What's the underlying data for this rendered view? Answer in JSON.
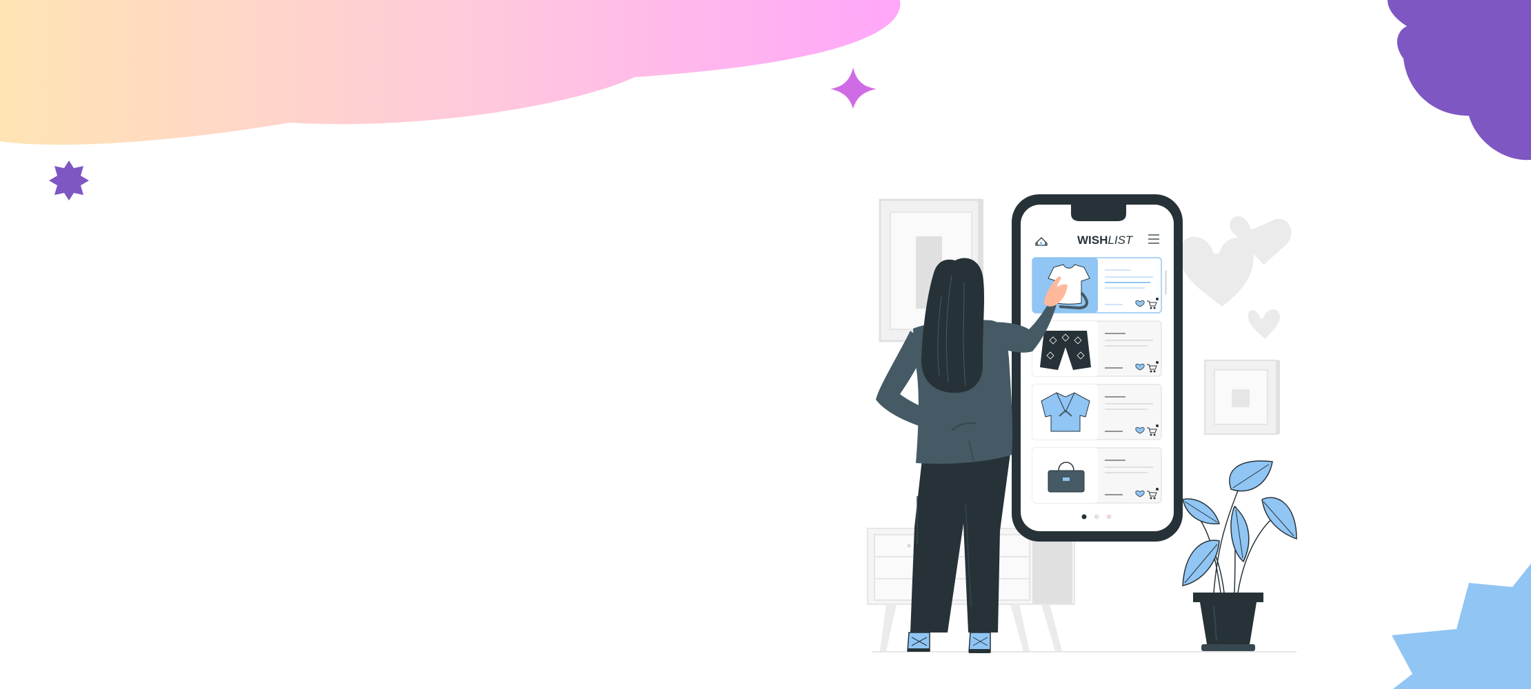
{
  "screen": {
    "title_bold": "WISH",
    "title_italic": "LIST",
    "icons": {
      "home": "home-icon",
      "menu": "hamburger-menu-icon",
      "favorite": "heart-icon",
      "cart": "cart-icon"
    },
    "products": [
      {
        "item": "t-shirt",
        "selected": true
      },
      {
        "item": "shorts",
        "selected": false
      },
      {
        "item": "shirt",
        "selected": false
      },
      {
        "item": "handbag",
        "selected": false
      }
    ],
    "pager": {
      "pages": 3,
      "active": 1
    }
  },
  "colors": {
    "accent_blue": "#90c5f4",
    "dark": "#263238",
    "jacket": "#455a64",
    "purple": "#7e57c2",
    "magenta_star": "#d06be6",
    "gradient_start": "#ffe4b3",
    "gradient_mid": "#ffc8dd",
    "gradient_end": "#ffa6fa"
  }
}
